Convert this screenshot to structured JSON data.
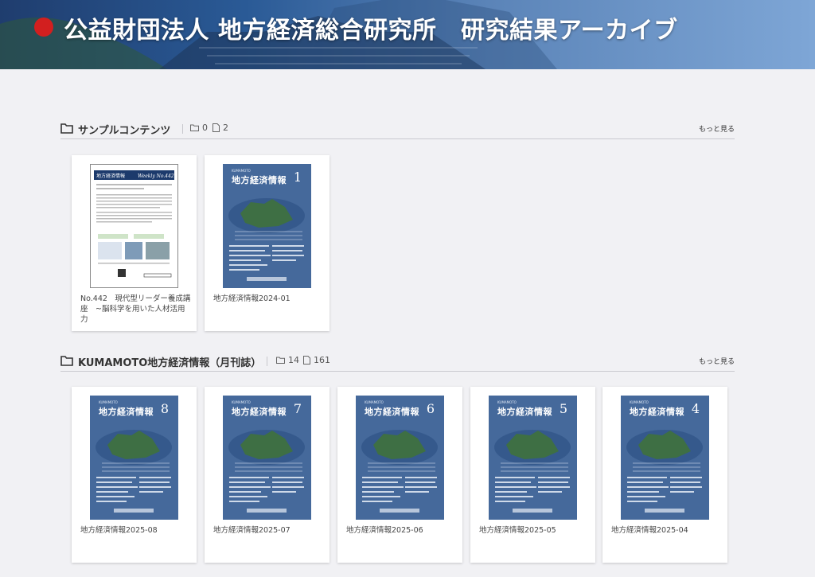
{
  "banner": {
    "title": "公益財団法人 地方経済総合研究所　研究結果アーカイブ"
  },
  "sections": [
    {
      "name": "サンプルコンテンツ",
      "folders": "0",
      "files": "2",
      "more": "もっと見る",
      "items": [
        {
          "label": "No.442　現代型リーダー養成講座　~脳科学を用いた人材活用力",
          "cover": "weekly",
          "cover_title": "地方経済情報",
          "cover_sub": "Weekly No.442"
        },
        {
          "label": "地方経済情報2024-01",
          "cover": "monthly",
          "cover_title": "地方経済情報",
          "cover_num": "1",
          "cover_sub": "KUMAMOTO"
        }
      ]
    },
    {
      "name": "KUMAMOTO地方経済情報（月刊誌）",
      "folders": "14",
      "files": "161",
      "more": "もっと見る",
      "items": [
        {
          "label": "地方経済情報2025-08",
          "cover": "monthly",
          "cover_title": "地方経済情報",
          "cover_num": "8",
          "cover_sub": "KUMAMOTO"
        },
        {
          "label": "地方経済情報2025-07",
          "cover": "monthly",
          "cover_title": "地方経済情報",
          "cover_num": "7",
          "cover_sub": "KUMAMOTO"
        },
        {
          "label": "地方経済情報2025-06",
          "cover": "monthly",
          "cover_title": "地方経済情報",
          "cover_num": "6",
          "cover_sub": "KUMAMOTO"
        },
        {
          "label": "地方経済情報2025-05",
          "cover": "monthly",
          "cover_title": "地方経済情報",
          "cover_num": "5",
          "cover_sub": "KUMAMOTO"
        },
        {
          "label": "地方経済情報2025-04",
          "cover": "monthly",
          "cover_title": "地方経済情報",
          "cover_num": "4",
          "cover_sub": "KUMAMOTO"
        }
      ]
    }
  ]
}
